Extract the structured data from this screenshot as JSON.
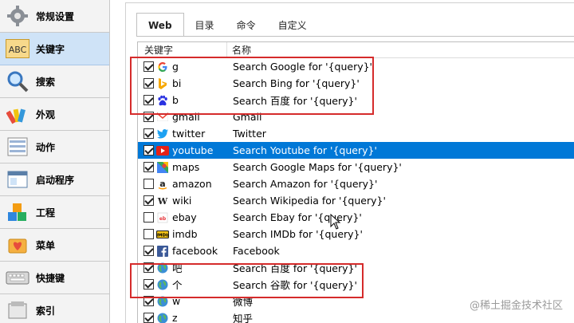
{
  "sidebar": {
    "items": [
      {
        "label": "常规设置",
        "icon": "settings-icon",
        "active": false
      },
      {
        "label": "关键字",
        "icon": "abc-icon",
        "active": true
      },
      {
        "label": "搜索",
        "icon": "magnifier-icon",
        "active": false
      },
      {
        "label": "外观",
        "icon": "palette-icon",
        "active": false
      },
      {
        "label": "动作",
        "icon": "actions-icon",
        "active": false
      },
      {
        "label": "启动程序",
        "icon": "window-icon",
        "active": false
      },
      {
        "label": "工程",
        "icon": "blocks-icon",
        "active": false
      },
      {
        "label": "菜单",
        "icon": "menu-icon",
        "active": false
      },
      {
        "label": "快捷键",
        "icon": "keyboard-icon",
        "active": false
      },
      {
        "label": "索引",
        "icon": "index-icon",
        "active": false
      }
    ]
  },
  "tabs": [
    {
      "label": "Web",
      "active": true
    },
    {
      "label": "目录",
      "active": false
    },
    {
      "label": "命令",
      "active": false
    },
    {
      "label": "自定义",
      "active": false
    }
  ],
  "list": {
    "headers": {
      "keyword": "关键字",
      "name": "名称"
    },
    "rows": [
      {
        "checked": true,
        "icon": "google-icon",
        "keyword": "g",
        "name": "Search Google for '{query}'"
      },
      {
        "checked": true,
        "icon": "bing-icon",
        "keyword": "bi",
        "name": "Search Bing for '{query}'"
      },
      {
        "checked": true,
        "icon": "baidu-icon",
        "keyword": "b",
        "name": "Search 百度 for '{query}'"
      },
      {
        "checked": true,
        "icon": "gmail-icon",
        "keyword": "gmail",
        "name": "Gmail"
      },
      {
        "checked": true,
        "icon": "twitter-icon",
        "keyword": "twitter",
        "name": "Twitter"
      },
      {
        "checked": true,
        "icon": "youtube-icon",
        "keyword": "youtube",
        "name": "Search Youtube for '{query}'",
        "selected": true
      },
      {
        "checked": true,
        "icon": "maps-icon",
        "keyword": "maps",
        "name": "Search Google Maps for '{query}'"
      },
      {
        "checked": false,
        "icon": "amazon-icon",
        "keyword": "amazon",
        "name": "Search Amazon for '{query}'"
      },
      {
        "checked": true,
        "icon": "wikipedia-icon",
        "keyword": "wiki",
        "name": "Search Wikipedia for '{query}'"
      },
      {
        "checked": false,
        "icon": "ebay-icon",
        "keyword": "ebay",
        "name": "Search Ebay for '{query}'"
      },
      {
        "checked": false,
        "icon": "imdb-icon",
        "keyword": "imdb",
        "name": "Search IMDb for '{query}'"
      },
      {
        "checked": true,
        "icon": "facebook-icon",
        "keyword": "facebook",
        "name": "Facebook"
      },
      {
        "checked": true,
        "icon": "globe-icon",
        "keyword": "吧",
        "name": "Search 百度 for '{query}'"
      },
      {
        "checked": true,
        "icon": "globe-icon",
        "keyword": "个",
        "name": "Search 谷歌 for '{query}'"
      },
      {
        "checked": true,
        "icon": "globe-icon",
        "keyword": "w",
        "name": "微博"
      },
      {
        "checked": true,
        "icon": "globe-icon",
        "keyword": "z",
        "name": "知乎"
      }
    ]
  },
  "watermark": "@稀土掘金技术社区",
  "colors": {
    "selection": "#0078d7",
    "highlight_box": "#d52b2b",
    "sidebar_active": "#cfe3f7"
  }
}
